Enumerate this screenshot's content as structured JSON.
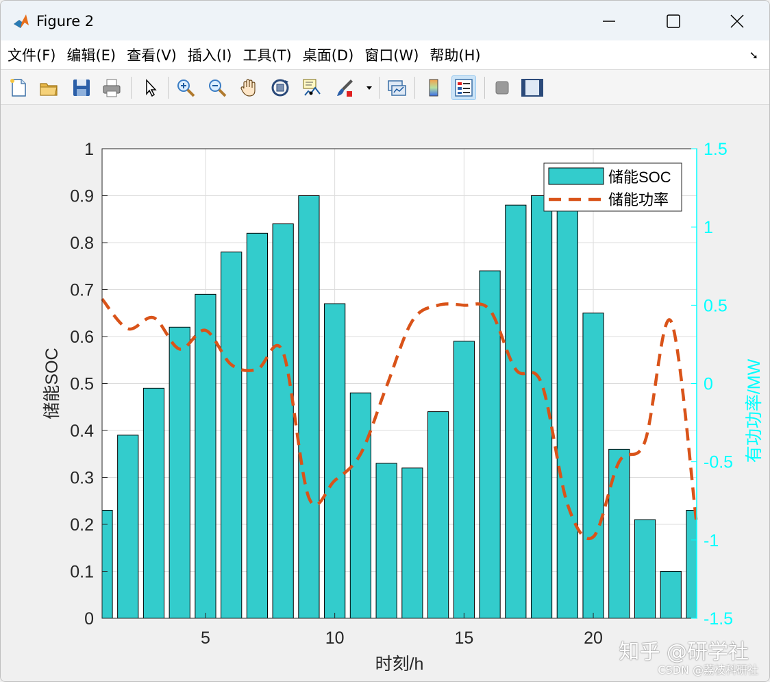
{
  "window": {
    "title": "Figure 2",
    "controls": [
      "minimize",
      "maximize",
      "close"
    ]
  },
  "menu": [
    "文件(F)",
    "编辑(E)",
    "查看(V)",
    "插入(I)",
    "工具(T)",
    "桌面(D)",
    "窗口(W)",
    "帮助(H)"
  ],
  "toolbar": [
    {
      "icon": "new-figure-icon"
    },
    {
      "icon": "open-file-icon"
    },
    {
      "icon": "save-icon"
    },
    {
      "icon": "print-icon"
    },
    {
      "icon": "pointer-icon"
    },
    {
      "icon": "zoom-in-icon"
    },
    {
      "icon": "zoom-out-icon"
    },
    {
      "icon": "pan-icon"
    },
    {
      "icon": "rotate-3d-icon"
    },
    {
      "icon": "data-cursor-icon"
    },
    {
      "icon": "brush-icon"
    },
    {
      "icon": "link-plot-icon"
    },
    {
      "icon": "colorbar-icon"
    },
    {
      "icon": "legend-icon",
      "active": true
    },
    {
      "icon": "hide-plot-tools-icon"
    },
    {
      "icon": "show-plot-tools-icon"
    }
  ],
  "chart_data": {
    "type": "bar",
    "xlabel": "时刻/h",
    "ylabel_left": "储能SOC",
    "ylabel_right": "有功功率/MW",
    "x": [
      1,
      2,
      3,
      4,
      5,
      6,
      7,
      8,
      9,
      10,
      11,
      12,
      13,
      14,
      15,
      16,
      17,
      18,
      19,
      20,
      21,
      22,
      23,
      24
    ],
    "xlim": [
      1,
      24
    ],
    "ylim_left": [
      0,
      1
    ],
    "ylim_right": [
      -1.5,
      1.5
    ],
    "xticks": [
      5,
      10,
      15,
      20
    ],
    "yticks_left": [
      "0",
      "0.1",
      "0.2",
      "0.3",
      "0.4",
      "0.5",
      "0.6",
      "0.7",
      "0.8",
      "0.9",
      "1"
    ],
    "yticks_right": [
      "-1.5",
      "-1",
      "-0.5",
      "0",
      "0.5",
      "1",
      "1.5"
    ],
    "grid": true,
    "legend_position": "top-right",
    "colors": {
      "bar": "#33cccc",
      "line": "#d95319",
      "right_axis": "#00ffff"
    },
    "series": [
      {
        "name": "储能SOC",
        "axis": "left",
        "style": "bar",
        "values": [
          0.23,
          0.39,
          0.49,
          0.62,
          0.69,
          0.78,
          0.82,
          0.84,
          0.9,
          0.67,
          0.48,
          0.33,
          0.32,
          0.44,
          0.59,
          0.74,
          0.88,
          0.9,
          0.9,
          0.65,
          0.36,
          0.21,
          0.1,
          0.23
        ]
      },
      {
        "name": "储能功率",
        "axis": "right",
        "style": "dashed-line",
        "values": [
          0.54,
          0.35,
          0.42,
          0.22,
          0.34,
          0.12,
          0.09,
          0.2,
          -0.73,
          -0.62,
          -0.45,
          -0.02,
          0.4,
          0.5,
          0.5,
          0.47,
          0.09,
          0.0,
          -0.77,
          -0.98,
          -0.5,
          -0.37,
          0.4,
          -0.9
        ]
      }
    ]
  },
  "watermark": {
    "main": "知乎 @研学社",
    "sub": "CSDN @荔枝科研社"
  }
}
